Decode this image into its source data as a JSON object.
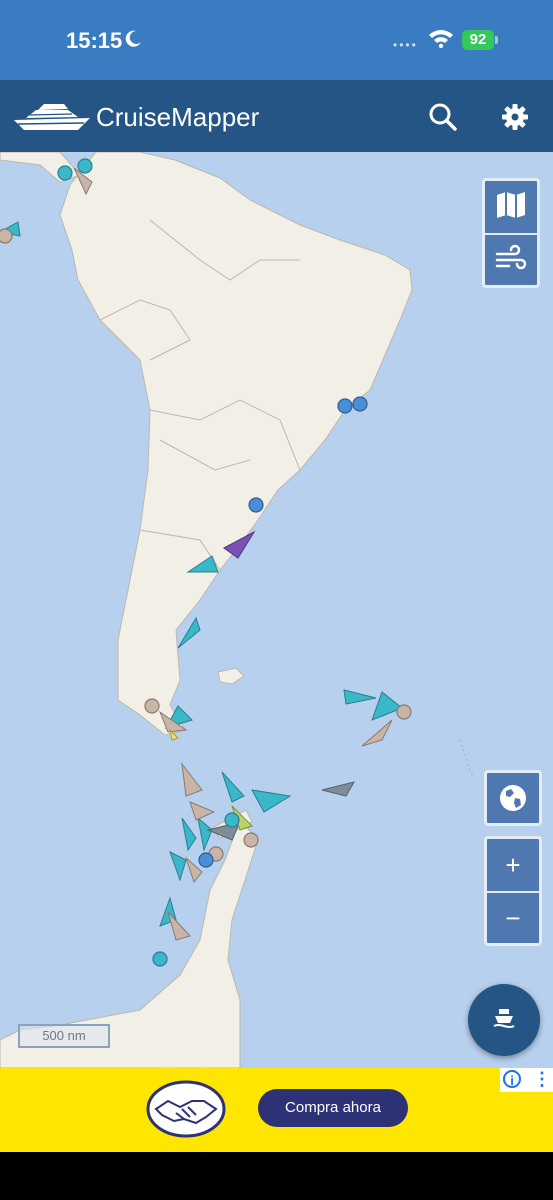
{
  "status_bar": {
    "time": "15:15",
    "dnd_icon": "moon-icon",
    "wifi_icon": "wifi-icon",
    "battery": "92"
  },
  "app_bar": {
    "title": "CruiseMapper",
    "logo_icon": "cruise-ship-logo-icon",
    "search_icon": "search-icon",
    "settings_icon": "gear-icon"
  },
  "map": {
    "scale_label": "500 nm",
    "controls": {
      "layers": "map-layers-icon",
      "weather": "wind-icon",
      "globe": "globe-icon",
      "zoom_in": "+",
      "zoom_out": "−"
    },
    "fab_icon": "ship-icon",
    "colors": {
      "ocean": "#b7d0ee",
      "land": "#f2efe7",
      "ship_teal": "#3ab7c8",
      "ship_tan": "#c9b5a8",
      "ship_gray": "#7d8d99",
      "ship_purple": "#7a52b3",
      "ship_blue": "#4a8fd6"
    }
  },
  "ad": {
    "button_label": "Compra ahora",
    "info_icon": "info-icon",
    "menu_icon": "kebab-menu-icon"
  }
}
